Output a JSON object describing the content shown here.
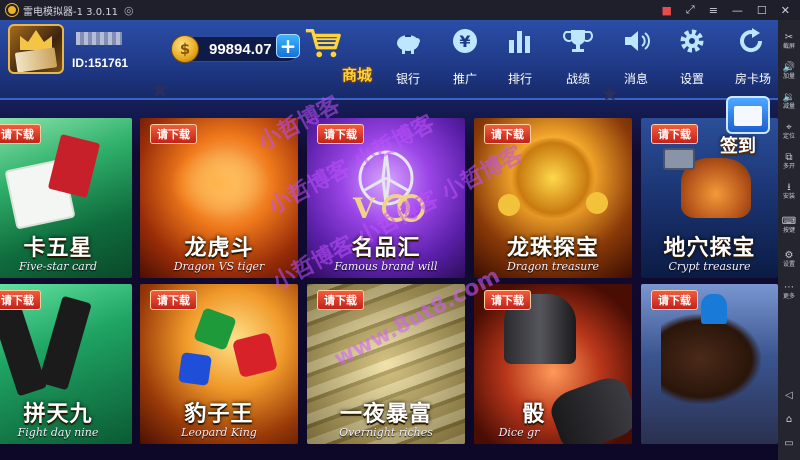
{
  "window": {
    "title": "雷电模拟器-1 3.0.11",
    "controls": [
      "gift-icon",
      "expand-icon",
      "menu-icon",
      "minimize-icon",
      "maximize-icon",
      "close-icon"
    ]
  },
  "user": {
    "id_label": "ID:151761"
  },
  "wallet": {
    "coin_glyph": "$",
    "balance": "99894.07",
    "add_label": "+"
  },
  "shop": {
    "label": "商城"
  },
  "nav": [
    {
      "key": "bank",
      "label": "银行",
      "icon": "piggy-bank-icon"
    },
    {
      "key": "promote",
      "label": "推广",
      "icon": "yen-icon"
    },
    {
      "key": "rank",
      "label": "排行",
      "icon": "bar-chart-icon"
    },
    {
      "key": "record",
      "label": "战绩",
      "icon": "trophy-icon"
    },
    {
      "key": "message",
      "label": "消息",
      "icon": "speaker-icon"
    },
    {
      "key": "settings",
      "label": "设置",
      "icon": "gear-icon"
    },
    {
      "key": "roomcard",
      "label": "房卡场",
      "icon": "refresh-icon"
    }
  ],
  "games": [
    {
      "name": "卡五星",
      "sub": "Five-star card",
      "badge": "请下载",
      "colors": [
        "#53c98a",
        "#0e6b3b"
      ]
    },
    {
      "name": "龙虎斗",
      "sub": "Dragon VS tiger",
      "badge": "请下载",
      "colors": [
        "#ff9a2a",
        "#6d1a08"
      ]
    },
    {
      "name": "名品汇",
      "sub": "Famous brand will",
      "badge": "请下载",
      "colors": [
        "#c07bff",
        "#4a1d8a"
      ]
    },
    {
      "name": "龙珠探宝",
      "sub": "Dragon treasure",
      "badge": "请下载",
      "colors": [
        "#f4a326",
        "#4a1304"
      ]
    },
    {
      "name": "地穴探宝",
      "sub": "Crypt treasure",
      "badge": "请下载",
      "colors": [
        "#3aa0ff",
        "#0b2d6b"
      ]
    },
    {
      "name": "拼天九",
      "sub": "Fight day nine",
      "badge": "请下载",
      "colors": [
        "#37d18c",
        "#0c5f3a"
      ]
    },
    {
      "name": "豹子王",
      "sub": "Leopard King",
      "badge": "请下载",
      "colors": [
        "#ffc84a",
        "#7a2c05"
      ]
    },
    {
      "name": "一夜暴富",
      "sub": "Overnight riches",
      "badge": "请下载",
      "colors": [
        "#e8c870",
        "#5a4a1a"
      ]
    },
    {
      "name": "骰",
      "sub": "Dice gr",
      "badge": "请下载",
      "colors": [
        "#ff7a3a",
        "#3a0b03"
      ]
    },
    {
      "name": "",
      "sub": "",
      "badge": "请下载",
      "colors": [
        "#6d8fd8",
        "#1c2a55"
      ]
    }
  ],
  "checkin": {
    "label": "签到"
  },
  "sidebar": [
    {
      "glyph": "✂",
      "label": "截屏",
      "icon": "scissors-icon"
    },
    {
      "glyph": "🔊",
      "label": "加量",
      "icon": "volume-up-icon"
    },
    {
      "glyph": "🔉",
      "label": "减量",
      "icon": "volume-down-icon"
    },
    {
      "glyph": "⌖",
      "label": "定位",
      "icon": "location-icon"
    },
    {
      "glyph": "⧉",
      "label": "多开",
      "icon": "multi-open-icon"
    },
    {
      "glyph": "⭳",
      "label": "安装",
      "icon": "install-icon"
    },
    {
      "glyph": "⌨",
      "label": "按键",
      "icon": "keyboard-icon"
    },
    {
      "glyph": "⚙",
      "label": "设置",
      "icon": "settings-icon"
    },
    {
      "glyph": "⋯",
      "label": "更多",
      "icon": "more-icon"
    },
    {
      "glyph": "◁",
      "label": "",
      "icon": "back-icon"
    },
    {
      "glyph": "⌂",
      "label": "",
      "icon": "home-icon"
    },
    {
      "glyph": "▭",
      "label": "",
      "icon": "recent-apps-icon"
    }
  ],
  "watermark": {
    "line1": "小哲博客",
    "line2": "小哲博客 小哲博客",
    "line3": "小哲博客 小哲博客 小哲博客",
    "url": "www.8ut8.com"
  }
}
